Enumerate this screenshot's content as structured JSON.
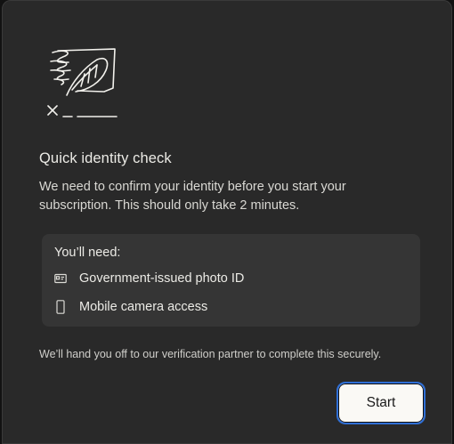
{
  "dialog": {
    "title": "Quick identity check",
    "description": "We need to confirm your identity before you start your subscription. This should only take 2 minutes.",
    "requirements": {
      "heading": "You’ll need:",
      "items": [
        {
          "icon": "id-card-icon",
          "label": "Government-issued photo ID"
        },
        {
          "icon": "smartphone-icon",
          "label": "Mobile camera access"
        }
      ]
    },
    "footnote": "We’ll hand you off to our verification partner to complete this securely.",
    "start_label": "Start"
  },
  "illustration": {
    "icon": "signature-document-illustration"
  },
  "colors": {
    "background": "#292929",
    "card": "#353535",
    "text": "#ecebe6",
    "button_bg": "#faf9f5",
    "focus_ring": "#2f6fd6"
  }
}
